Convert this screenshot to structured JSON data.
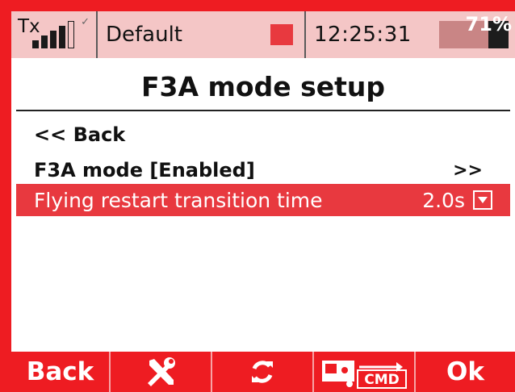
{
  "status_bar": {
    "tx_label": "Tx",
    "signal_bars_filled": 4,
    "signal_bars_total": 5,
    "profile_name": "Default",
    "time": "12:25:31",
    "battery_percent": 71,
    "battery_text": "71%"
  },
  "page": {
    "title": "F3A mode setup"
  },
  "menu": {
    "back_label": "<<  Back",
    "f3a_label": "F3A mode [Enabled]",
    "f3a_arrow": ">>",
    "flying_label": "Flying restart transition time",
    "flying_value": "2.0s"
  },
  "footer": {
    "back_label": "Back",
    "tools_icon": "wrench-screwdriver-icon",
    "refresh_icon": "refresh-icon",
    "cmd_icon": "transmitter-cmd-icon",
    "cmd_label": "CMD",
    "ok_label": "Ok"
  },
  "colors": {
    "frame_red": "#ee1c22",
    "highlight_red": "#e8393f",
    "status_pink": "#f4c6c6"
  }
}
